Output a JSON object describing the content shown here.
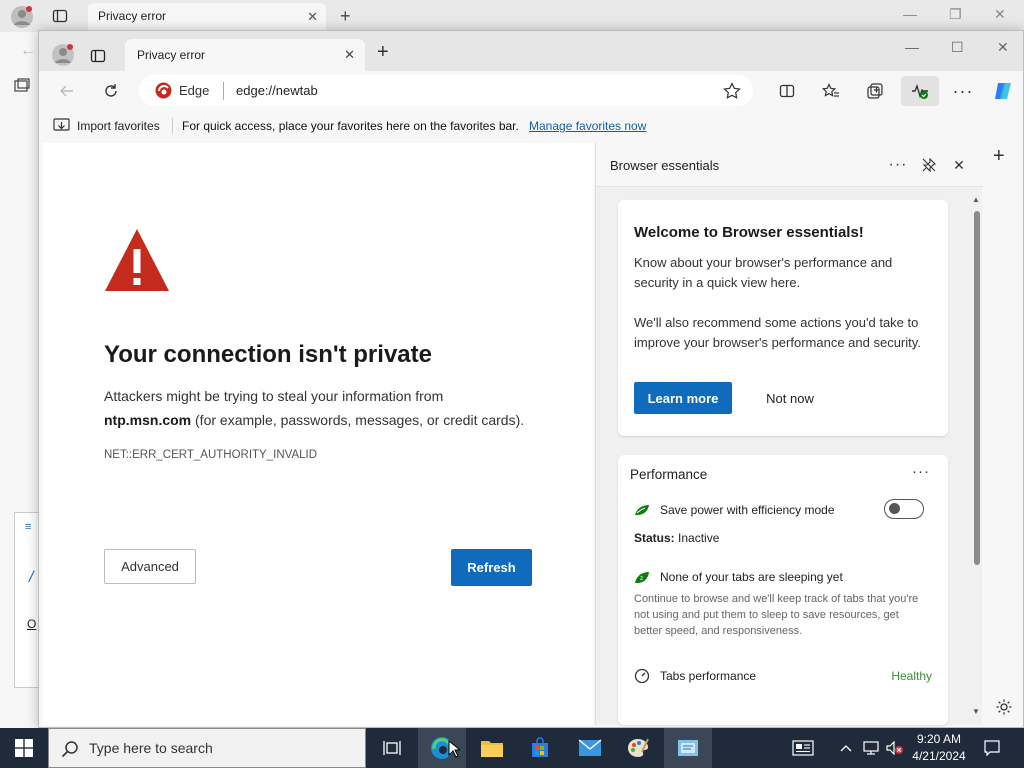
{
  "background_window": {
    "tab_title": "Privacy error"
  },
  "window": {
    "tab_title": "Privacy error"
  },
  "address_bar": {
    "site_label": "Edge",
    "url": "edge://newtab"
  },
  "favorites_bar": {
    "import_label": "Import favorites",
    "message": "For quick access, place your favorites here on the favorites bar.",
    "manage_link": "Manage favorites now"
  },
  "error_page": {
    "title": "Your connection isn't private",
    "desc_line1": "Attackers might be trying to steal your information from",
    "desc_host": "ntp.msn.com",
    "desc_line2_rest": " (for example, passwords, messages, or credit cards).",
    "error_code": "NET::ERR_CERT_AUTHORITY_INVALID",
    "advanced_label": "Advanced",
    "refresh_label": "Refresh"
  },
  "essentials_pane": {
    "title": "Browser essentials",
    "welcome": {
      "title": "Welcome to Browser essentials!",
      "paragraph1": "Know about your browser's performance and security in a quick view here.",
      "paragraph2": "We'll also recommend some actions you'd take to improve your browser's performance and security.",
      "learn_more": "Learn more",
      "not_now": "Not now"
    },
    "performance": {
      "title": "Performance",
      "efficiency_label": "Save power with efficiency mode",
      "status_label": "Status:",
      "status_value": "Inactive",
      "sleeping_title": "None of your tabs are sleeping yet",
      "sleeping_desc": "Continue to browse and we'll keep track of tabs that you're not using and put them to sleep to save resources, get better speed, and responsiveness.",
      "tabs_perf_label": "Tabs performance",
      "tabs_perf_status": "Healthy",
      "efficiency_toggle_on": false
    }
  },
  "taskbar": {
    "search_placeholder": "Type here to search",
    "time": "9:20 AM",
    "date": "4/21/2024"
  },
  "colors": {
    "accent_blue": "#0f6cbd",
    "error_red": "#c42b1c",
    "taskbar": "#1f2b3a",
    "healthy_green": "#3b8c3b"
  }
}
